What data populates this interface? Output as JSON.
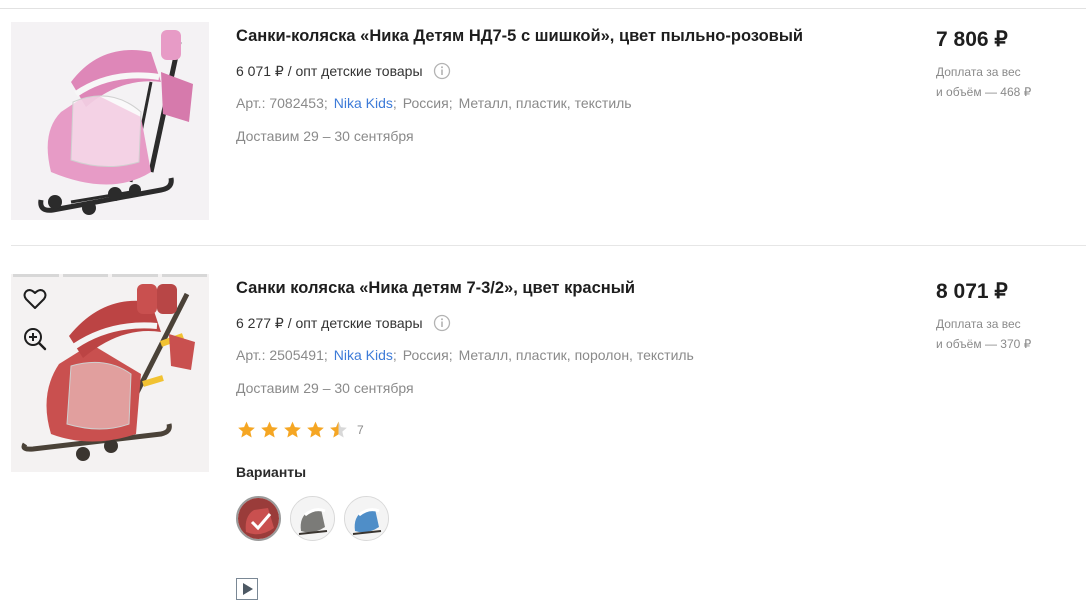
{
  "products": [
    {
      "title": "Санки-коляска «Ника Детям НД7-5 с шишкой», цвет пыльно-розовый",
      "opt_price": "6 071 ₽",
      "opt_label": "/ опт детские товары",
      "article_label": "Арт.:",
      "article": "7082453",
      "brand": "Nika Kids",
      "country": "Россия",
      "materials": "Металл, пластик, текстиль",
      "delivery": "Доставим 29 – 30 сентября",
      "price": "7 806 ₽",
      "surcharge_line1": "Доплата за вес",
      "surcharge_line2": "и объём — 468 ₽",
      "image_icon": "pink-sled-stroller-image",
      "colors": {
        "main": "#e79bc6"
      }
    },
    {
      "title": "Санки коляска «Ника детям 7-3/2», цвет красный",
      "opt_price": "6 277 ₽",
      "opt_label": "/ опт детские товары",
      "article_label": "Арт.:",
      "article": "2505491",
      "brand": "Nika Kids",
      "country": "Россия",
      "materials": "Металл, пластик, поролон, текстиль",
      "delivery": "Доставим 29 – 30 сентября",
      "price": "8 071 ₽",
      "surcharge_line1": "Доплата за вес",
      "surcharge_line2": "и объём — 370 ₽",
      "rating": 4.5,
      "rating_max": 5,
      "review_count": "7",
      "variants_label": "Варианты",
      "variants": [
        {
          "icon": "red-variant-thumb",
          "selected": true
        },
        {
          "icon": "gray-variant-thumb",
          "selected": false
        },
        {
          "icon": "blue-variant-thumb",
          "selected": false
        }
      ],
      "image_icon": "red-sled-stroller-image",
      "colors": {
        "main": "#c9504f"
      }
    }
  ],
  "separator": ";",
  "icons": {
    "favorite": "heart-icon",
    "zoom": "zoom-in-icon",
    "info": "info-icon",
    "star": "star-icon",
    "video": "play-icon"
  },
  "colors": {
    "brand_link": "#3d7bd8",
    "star": "#f5a623",
    "muted_text": "#8a8a8a"
  }
}
